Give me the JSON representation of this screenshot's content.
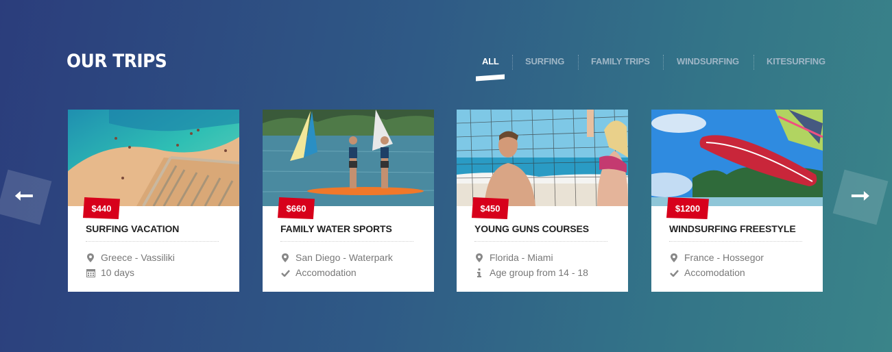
{
  "header": {
    "title": "OUR TRIPS"
  },
  "filters": [
    {
      "label": "ALL",
      "active": true
    },
    {
      "label": "SURFING",
      "active": false
    },
    {
      "label": "FAMILY TRIPS",
      "active": false
    },
    {
      "label": "WINDSURFING",
      "active": false
    },
    {
      "label": "KITESURFING",
      "active": false
    }
  ],
  "trips": [
    {
      "price": "$440",
      "name": "SURFING VACATION",
      "meta1_icon": "map-marker-icon",
      "meta1": "Greece - Vassiliki",
      "meta2_icon": "calendar-icon",
      "meta2": "10 days",
      "image": "beach-stairs-photo"
    },
    {
      "price": "$660",
      "name": "FAMILY WATER SPORTS",
      "meta1_icon": "map-marker-icon",
      "meta1": "San Diego - Waterpark",
      "meta2_icon": "check-icon",
      "meta2": "Accomodation",
      "image": "paddleboard-lake-photo"
    },
    {
      "price": "$450",
      "name": "YOUNG GUNS COURSES",
      "meta1_icon": "map-marker-icon",
      "meta1": "Florida - Miami",
      "meta2_icon": "info-icon",
      "meta2": "Age group from 14 - 18",
      "image": "beach-volleyball-photo"
    },
    {
      "price": "$1200",
      "name": "WINDSURFING FREESTYLE",
      "meta1_icon": "map-marker-icon",
      "meta1": "France - Hossegor",
      "meta2_icon": "check-icon",
      "meta2": "Accomodation",
      "image": "windsurf-jump-photo"
    }
  ],
  "navigation": {
    "prev_icon": "arrow-left-icon",
    "next_icon": "arrow-right-icon"
  },
  "colors": {
    "accent": "#d7001b",
    "bg_start": "#2b3d7c",
    "bg_end": "#3a8489",
    "filter_inactive": "#9fb6c6"
  }
}
